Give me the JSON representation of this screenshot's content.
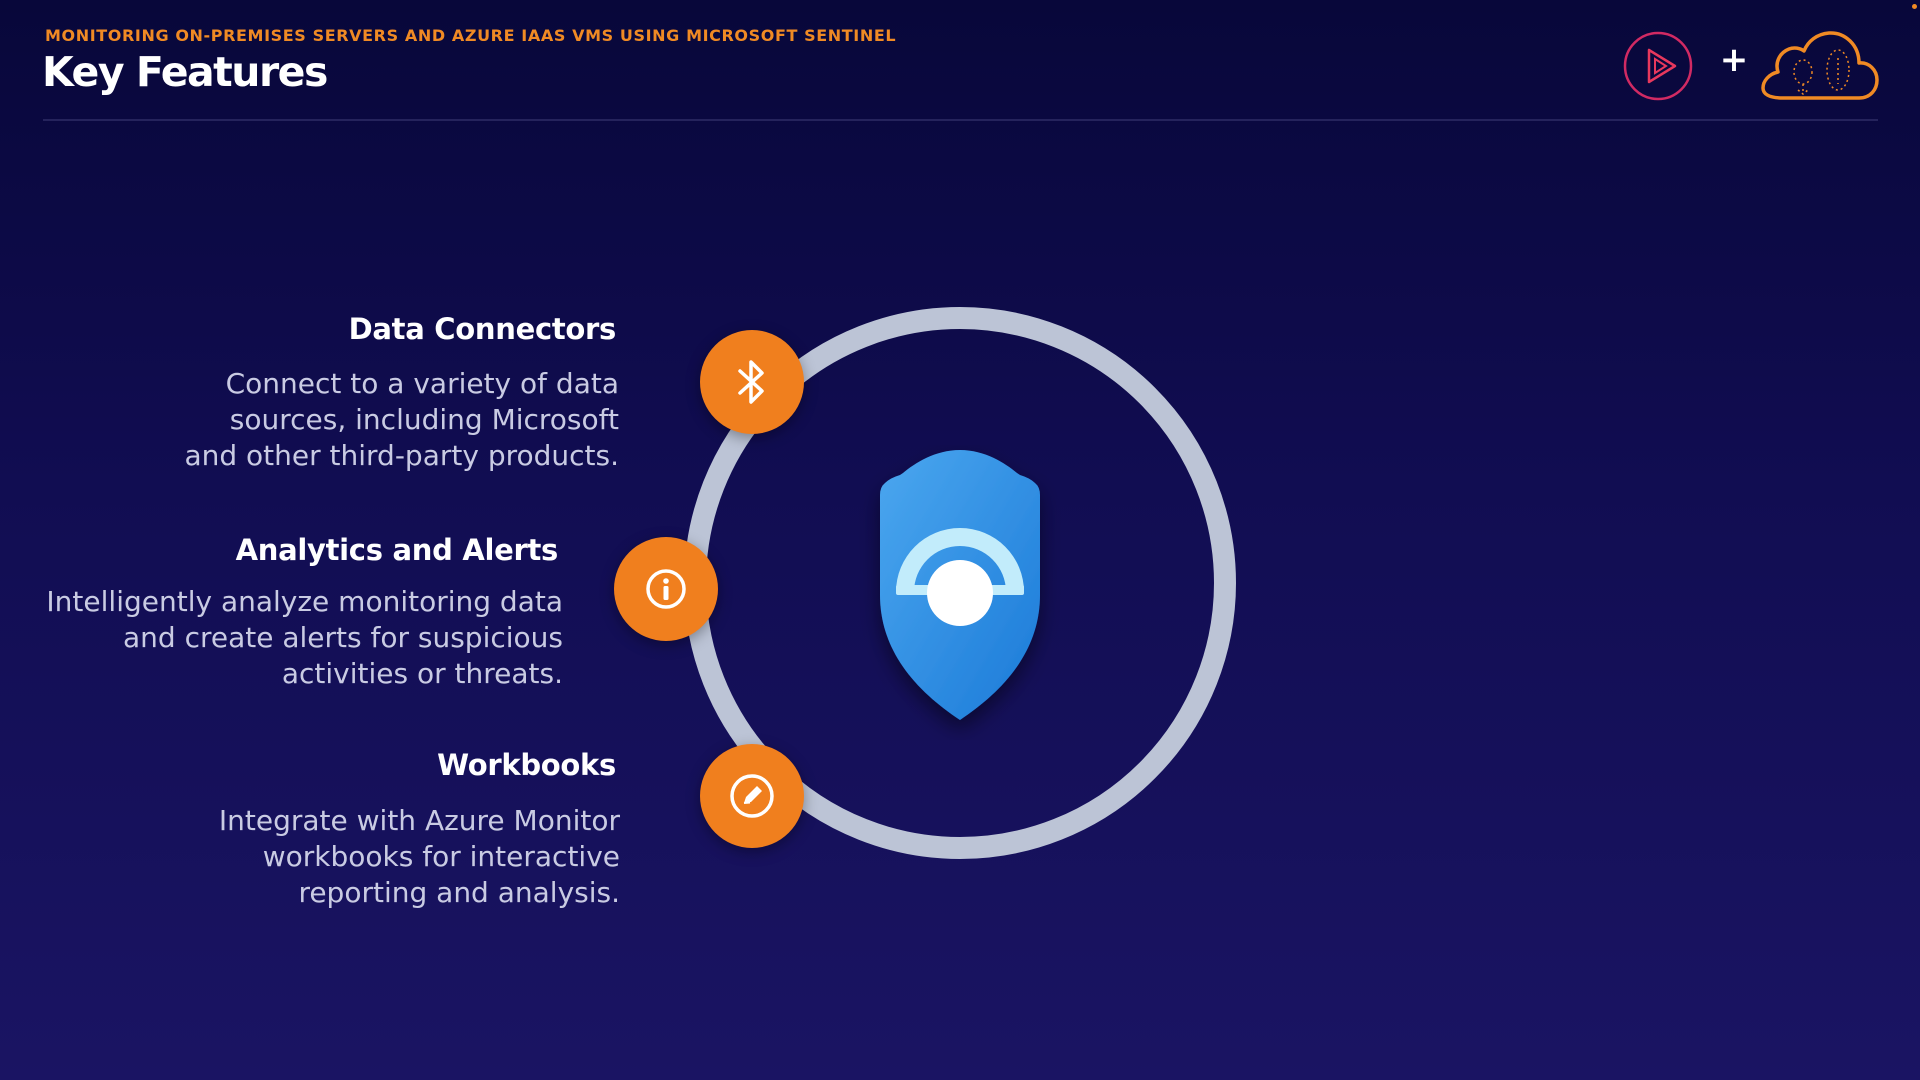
{
  "header": {
    "eyebrow": "MONITORING ON-PREMISES SERVERS AND AZURE IAAS VMS USING MICROSOFT SENTINEL",
    "title": "Key Features"
  },
  "brand": {
    "plus": "+",
    "play_icon": "play-icon",
    "cloud_icon": "cloud-icon"
  },
  "center_icon": "shield-icon",
  "features": [
    {
      "title": "Data Connectors",
      "description": "Connect to a variety of data\nsources, including Microsoft\nand other third-party products.",
      "icon": "bluetooth-icon"
    },
    {
      "title": "Analytics and Alerts",
      "description": "Intelligently analyze monitoring data\nand create alerts for suspicious\nactivities or threats.",
      "icon": "info-icon"
    },
    {
      "title": "Workbooks",
      "description": "Integrate with Azure Monitor\nworkbooks for interactive\nreporting and analysis.",
      "icon": "pencil-icon"
    }
  ],
  "colors": {
    "accent": "#f07f1e",
    "ring": "#bcc4d6",
    "background": "#110d52",
    "shield": "#2a8cdf"
  }
}
